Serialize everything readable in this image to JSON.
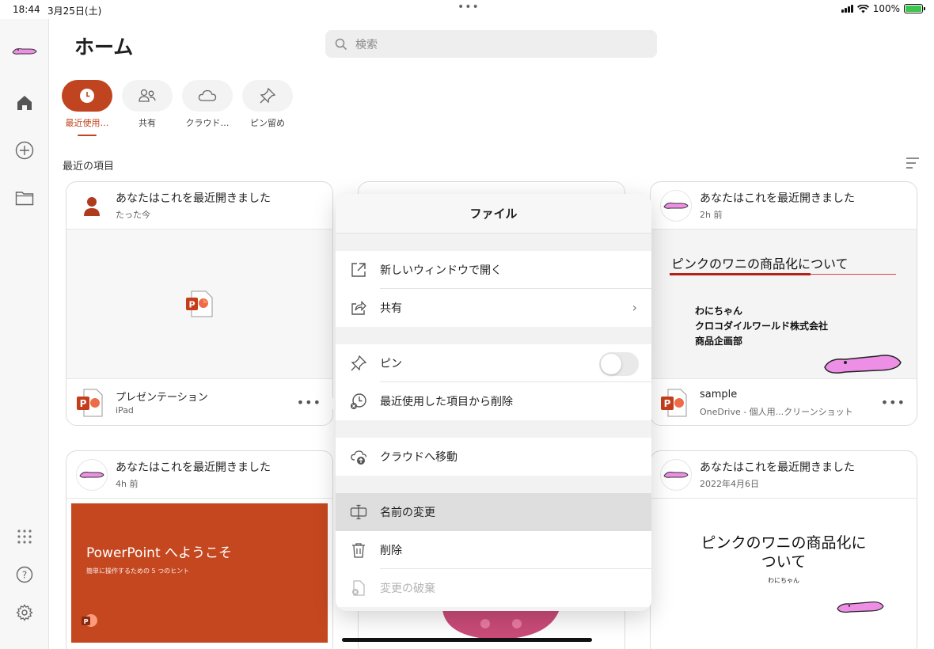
{
  "status": {
    "time": "18:44",
    "date": "3月25日(土)",
    "battery": "100%",
    "dots": "•••"
  },
  "header": {
    "title": "ホーム",
    "search_placeholder": "検索"
  },
  "tabs": [
    {
      "label": "最近使用…",
      "icon": "clock-icon",
      "active": true
    },
    {
      "label": "共有",
      "icon": "people-icon",
      "active": false
    },
    {
      "label": "クラウド…",
      "icon": "cloud-icon",
      "active": false
    },
    {
      "label": "ピン留め",
      "icon": "pin-icon",
      "active": false
    }
  ],
  "section_title": "最近の項目",
  "cards": [
    {
      "heading": "あなたはこれを最近開きました",
      "time": "たった今",
      "file_name": "プレゼンテーション",
      "location": "iPad",
      "more": "•••"
    },
    {
      "heading": "あなたはこれを最近開きました",
      "time": "2h 前",
      "file_name": "sample",
      "location": "OneDrive - 個人用...クリーンショット",
      "more": "•••",
      "slide": {
        "title": "ピンクのワニの商品化について",
        "lines": [
          "わにちゃん",
          "クロコダイルワールド株式会社",
          "商品企画部"
        ]
      }
    },
    {
      "heading": "あなたはこれを最近開きました",
      "time": "4h 前",
      "slide": {
        "title": "PowerPoint へようこそ",
        "subtitle": "簡単に操作するための 5 つのヒント"
      }
    },
    {
      "heading": "あなたはこれを最近開きました",
      "time": "2022年4月6日",
      "slide": {
        "title_line1": "ピンクのワニの商品化に",
        "title_line2": "ついて",
        "subtitle": "わにちゃん"
      }
    }
  ],
  "popover": {
    "title": "ファイル",
    "items": {
      "open_new_window": "新しいウィンドウで開く",
      "share": "共有",
      "pin": "ピン",
      "remove_recent": "最近使用した項目から削除",
      "move_cloud": "クラウドへ移動",
      "rename": "名前の変更",
      "delete": "削除",
      "discard": "変更の破棄"
    },
    "pin_toggle_on": false
  },
  "colors": {
    "accent": "#c0441f",
    "ppt_red": "#c5471f",
    "croc_pink": "#ee8fe6"
  }
}
